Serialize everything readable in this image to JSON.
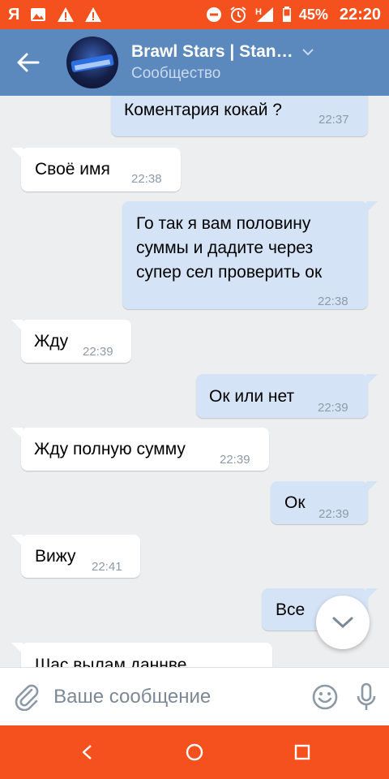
{
  "status_bar": {
    "carrier": "Я",
    "battery": "45%",
    "network": "H",
    "time": "22:20",
    "icons": [
      "yandex-icon",
      "image-icon",
      "warning-icon",
      "warning-icon",
      "dnd-icon",
      "alarm-icon",
      "signal-icon",
      "battery-icon"
    ]
  },
  "header": {
    "title": "Brawl Stars | Stan…",
    "subtitle": "Сообщество"
  },
  "messages": [
    {
      "dir": "out",
      "text": "Коментария кокай ?",
      "time": "22:37"
    },
    {
      "dir": "in",
      "text": "Своё имя",
      "time": "22:38"
    },
    {
      "dir": "out",
      "lines": [
        "Го так я вам половину",
        "суммы и дадите через",
        "супер сел проверить ок"
      ],
      "time": "22:38"
    },
    {
      "dir": "in",
      "text": "Жду",
      "time": "22:39"
    },
    {
      "dir": "out",
      "text": "Ок или нет",
      "time": "22:39"
    },
    {
      "dir": "in",
      "text": "Жду полную сумму",
      "time": "22:39"
    },
    {
      "dir": "out",
      "text": "Ок",
      "time": "22:39"
    },
    {
      "dir": "in",
      "text": "Вижу",
      "time": "22:41"
    },
    {
      "dir": "out",
      "text": "Все",
      "time": ""
    },
    {
      "dir": "in",
      "text": "Шас вылам даннве",
      "time": ""
    }
  ],
  "composer": {
    "placeholder": "Ваше сообщение"
  },
  "colors": {
    "status_bar": "#f4511e",
    "header": "#5b88bd",
    "chat_bg": "#edeef0",
    "bubble_out": "#d4e4f6",
    "bubble_in": "#ffffff"
  }
}
